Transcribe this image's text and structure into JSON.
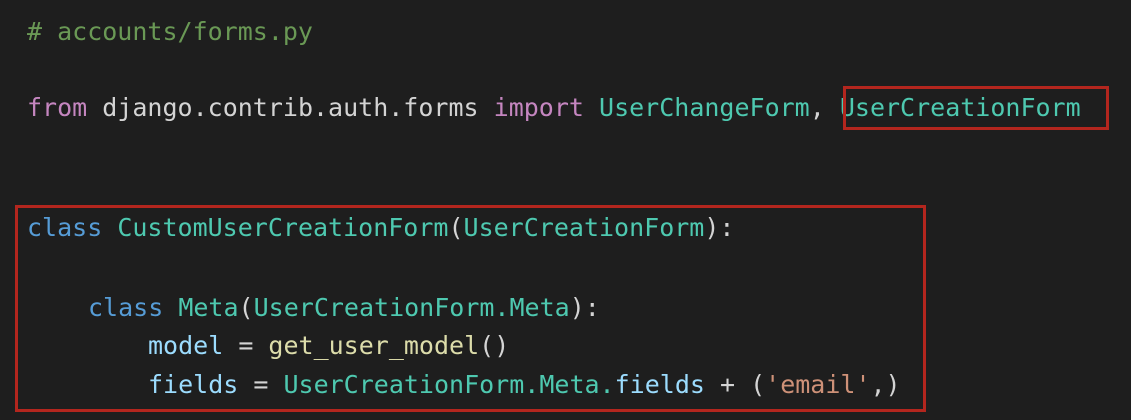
{
  "code": {
    "filename_comment": "# accounts/forms.py",
    "import_line": {
      "from_kw": "from",
      "module": "django.contrib.auth.forms",
      "import_kw": "import",
      "name1": "UserChangeForm",
      "comma": ", ",
      "name2": "UserCreationForm"
    },
    "class_line": {
      "class_kw": "class",
      "class_name": "CustomUserCreationForm",
      "open_paren": "(",
      "base": "UserCreationForm",
      "close": "):"
    },
    "meta_line": {
      "class_kw": "class",
      "name": "Meta",
      "open_paren": "(",
      "base": "UserCreationForm.Meta",
      "close": "):"
    },
    "model_line": {
      "attr": "model",
      "op": " = ",
      "func": "get_user_model",
      "call": "()"
    },
    "fields_line": {
      "attr": "fields",
      "op": " = ",
      "ref": "UserCreationForm.Meta.",
      "ref_attr": "fields",
      "plus": " + (",
      "string": "'email'",
      "end": ",)"
    }
  },
  "highlight_color": "#b3261e"
}
